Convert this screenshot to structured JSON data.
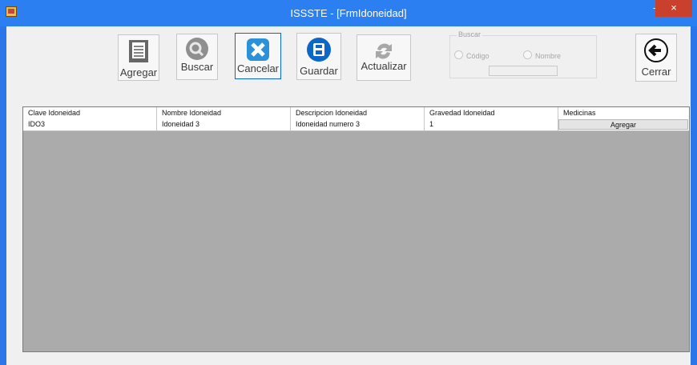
{
  "window": {
    "title": "ISSSTE - [FrmIdoneidad]",
    "minimize_glyph": "–",
    "maximize_glyph": "□",
    "close_glyph": "×"
  },
  "toolbar": {
    "agregar": "Agregar",
    "buscar": "Buscar",
    "cancelar": "Cancelar",
    "guardar": "Guardar",
    "actualizar": "Actualizar",
    "cerrar": "Cerrar"
  },
  "search": {
    "group_title": "Buscar",
    "option_codigo": "Código",
    "option_nombre": "Nombre",
    "value": ""
  },
  "grid": {
    "columns": [
      "Clave Idoneidad",
      "Nombre Idoneidad",
      "Descripcion Idoneidad",
      "Gravedad Idoneidad",
      "Medicinas"
    ],
    "rows": [
      {
        "clave": "IDO3",
        "nombre": "Idoneidad 3",
        "descripcion": "Idoneidad numero 3",
        "gravedad": "1",
        "medicinas_button": "Agregar"
      }
    ]
  },
  "colors": {
    "title_bar": "#2b7ff0",
    "client_background": "#f0f0f0",
    "grid_background": "#ababab",
    "close_button": "#c9412d",
    "active_button_border": "#0a65d8"
  },
  "icons": {
    "app": "application-icon",
    "agregar": "document-icon",
    "buscar": "search-icon",
    "cancelar": "close-icon",
    "guardar": "save-icon",
    "actualizar": "refresh-icon",
    "cerrar": "back-arrow-icon"
  }
}
